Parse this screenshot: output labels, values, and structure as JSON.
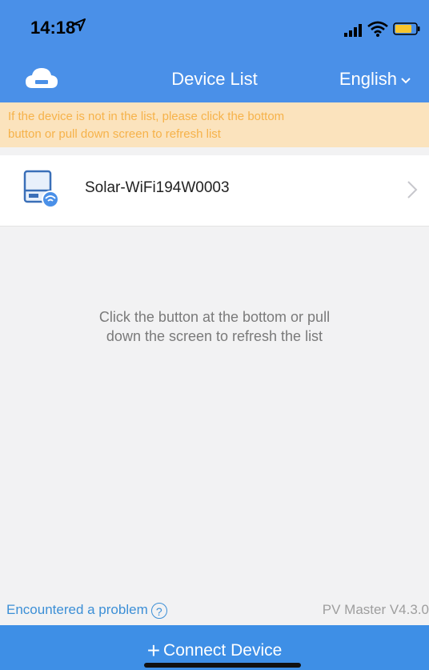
{
  "status": {
    "time": "14:18"
  },
  "nav": {
    "title": "Device List",
    "language": "English"
  },
  "notice": {
    "line1": "If the device is not in the list, please click the bottom",
    "line2": "button or pull down screen to refresh list"
  },
  "devices": [
    {
      "name": "Solar-WiFi194W0003"
    }
  ],
  "empty": {
    "line1": "Click the button at the bottom or pull",
    "line2": "down the screen to refresh the list"
  },
  "footer": {
    "problem": "Encountered a problem",
    "version": "PV Master V4.3.0"
  },
  "bottom": {
    "connect_label": "Connect Device"
  },
  "colors": {
    "primary": "#4a90e8",
    "notice_bg": "#fbe3bd",
    "notice_text": "#f6b24a",
    "link": "#3c8fd6"
  },
  "icons": {
    "cloud": "cloud-icon",
    "device": "inverter-device-icon",
    "chevron": "chevron-right-icon",
    "help": "question-circle-icon"
  }
}
